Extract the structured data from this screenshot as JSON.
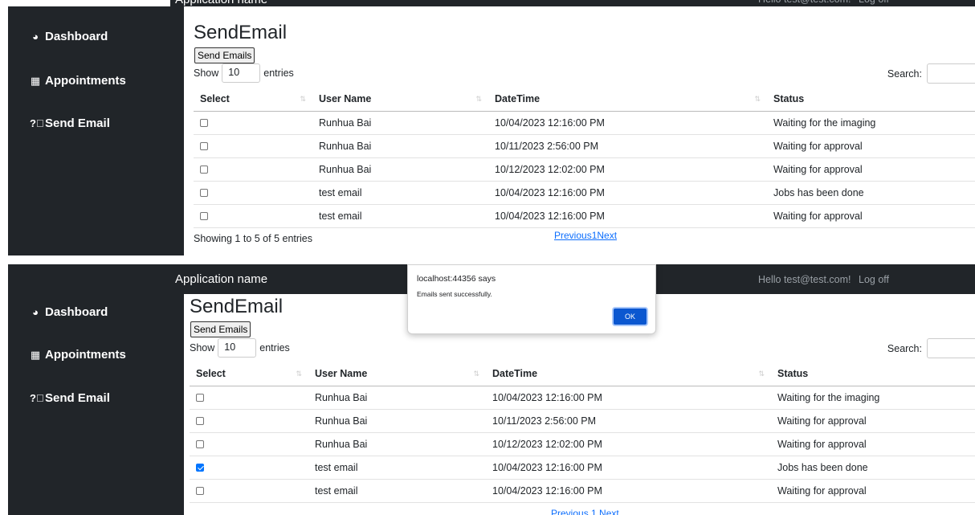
{
  "nav": {
    "brand": "Application name",
    "hello": "Hello test@test.com!",
    "logoff": "Log off"
  },
  "sidebar": {
    "items": [
      {
        "label": "Dashboard",
        "icon": "dashboard-gauge-icon"
      },
      {
        "label": "Appointments",
        "icon": "calendar-icon"
      },
      {
        "label": "Send Email",
        "icon": "question-circle-icon"
      }
    ]
  },
  "page": {
    "title": "SendEmail",
    "send_button": "Send Emails",
    "show_label": "Show",
    "entries_value": "10",
    "entries_label": "entries",
    "search_label": "Search:",
    "columns": [
      "Select",
      "User Name",
      "DateTime",
      "Status"
    ],
    "info": "Showing 1 to 5 of 5 entries",
    "pagination": "Previous1Next",
    "pagination_partial": "Previous 1 Next"
  },
  "rows": [
    {
      "user": "Runhua Bai",
      "datetime": "10/04/2023 12:16:00 PM",
      "status": "Waiting for the imaging"
    },
    {
      "user": "Runhua Bai",
      "datetime": "10/11/2023 2:56:00 PM",
      "status": "Waiting for approval"
    },
    {
      "user": "Runhua Bai",
      "datetime": "10/12/2023 12:02:00 PM",
      "status": "Waiting for approval"
    },
    {
      "user": "test email",
      "datetime": "10/04/2023 12:16:00 PM",
      "status": "Jobs has been done"
    },
    {
      "user": "test email",
      "datetime": "10/04/2023 12:16:00 PM",
      "status": "Waiting for approval"
    }
  ],
  "bottom_checked": [
    false,
    false,
    false,
    true,
    false
  ],
  "dialog": {
    "title": "localhost:44356 says",
    "message": "Emails sent successfully.",
    "ok": "OK"
  },
  "colors": {
    "sidebar_bg": "#212529",
    "link": "#0d6efd",
    "ok_button": "#0b57d0",
    "checkbox_checked": "#0075ff"
  }
}
